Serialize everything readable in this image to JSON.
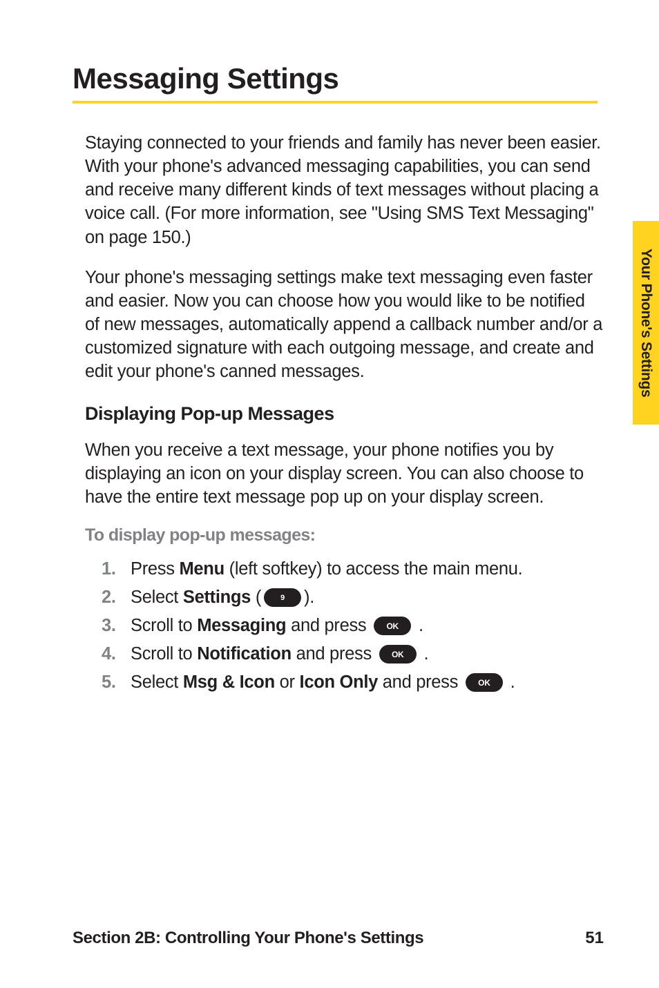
{
  "heading": "Messaging Settings",
  "para1": "Staying connected to your friends and family has never been easier. With your phone's advanced messaging capabilities, you can send and receive many different kinds of text messages without placing a voice call. (For more information, see \"Using SMS Text Messaging\" on page 150.)",
  "para2": "Your phone's messaging settings make text messaging even faster and easier. Now you can choose how you would like to be notified of new messages, automatically append a callback number and/or a customized signature with each outgoing message, and create and edit your phone's canned messages.",
  "subheading": "Displaying Pop-up Messages",
  "para3": "When you receive a text message, your phone notifies you by displaying an icon on your display screen. You can also choose to have the entire text message pop up on your display screen.",
  "instruction_lead": "To display pop-up messages:",
  "steps": {
    "s1": {
      "num": "1.",
      "pre": "Press ",
      "b1": "Menu",
      "post": " (left softkey) to access the main menu."
    },
    "s2": {
      "num": "2.",
      "pre": "Select ",
      "b1": "Settings",
      "open": " (",
      "key": "9",
      "close": ")."
    },
    "s3": {
      "num": "3.",
      "pre": "Scroll to ",
      "b1": "Messaging",
      "mid": " and press ",
      "key": "OK",
      "post": " ."
    },
    "s4": {
      "num": "4.",
      "pre": "Scroll to ",
      "b1": "Notification",
      "mid": " and press ",
      "key": "OK",
      "post": " ."
    },
    "s5": {
      "num": "5.",
      "pre": "Select ",
      "b1": "Msg & Icon",
      "or": " or ",
      "b2": "Icon Only",
      "mid": " and press ",
      "key": "OK",
      "post": " ."
    }
  },
  "sidetab": "Your Phone's Settings",
  "footer_left": "Section 2B: Controlling Your Phone's Settings",
  "footer_page": "51"
}
